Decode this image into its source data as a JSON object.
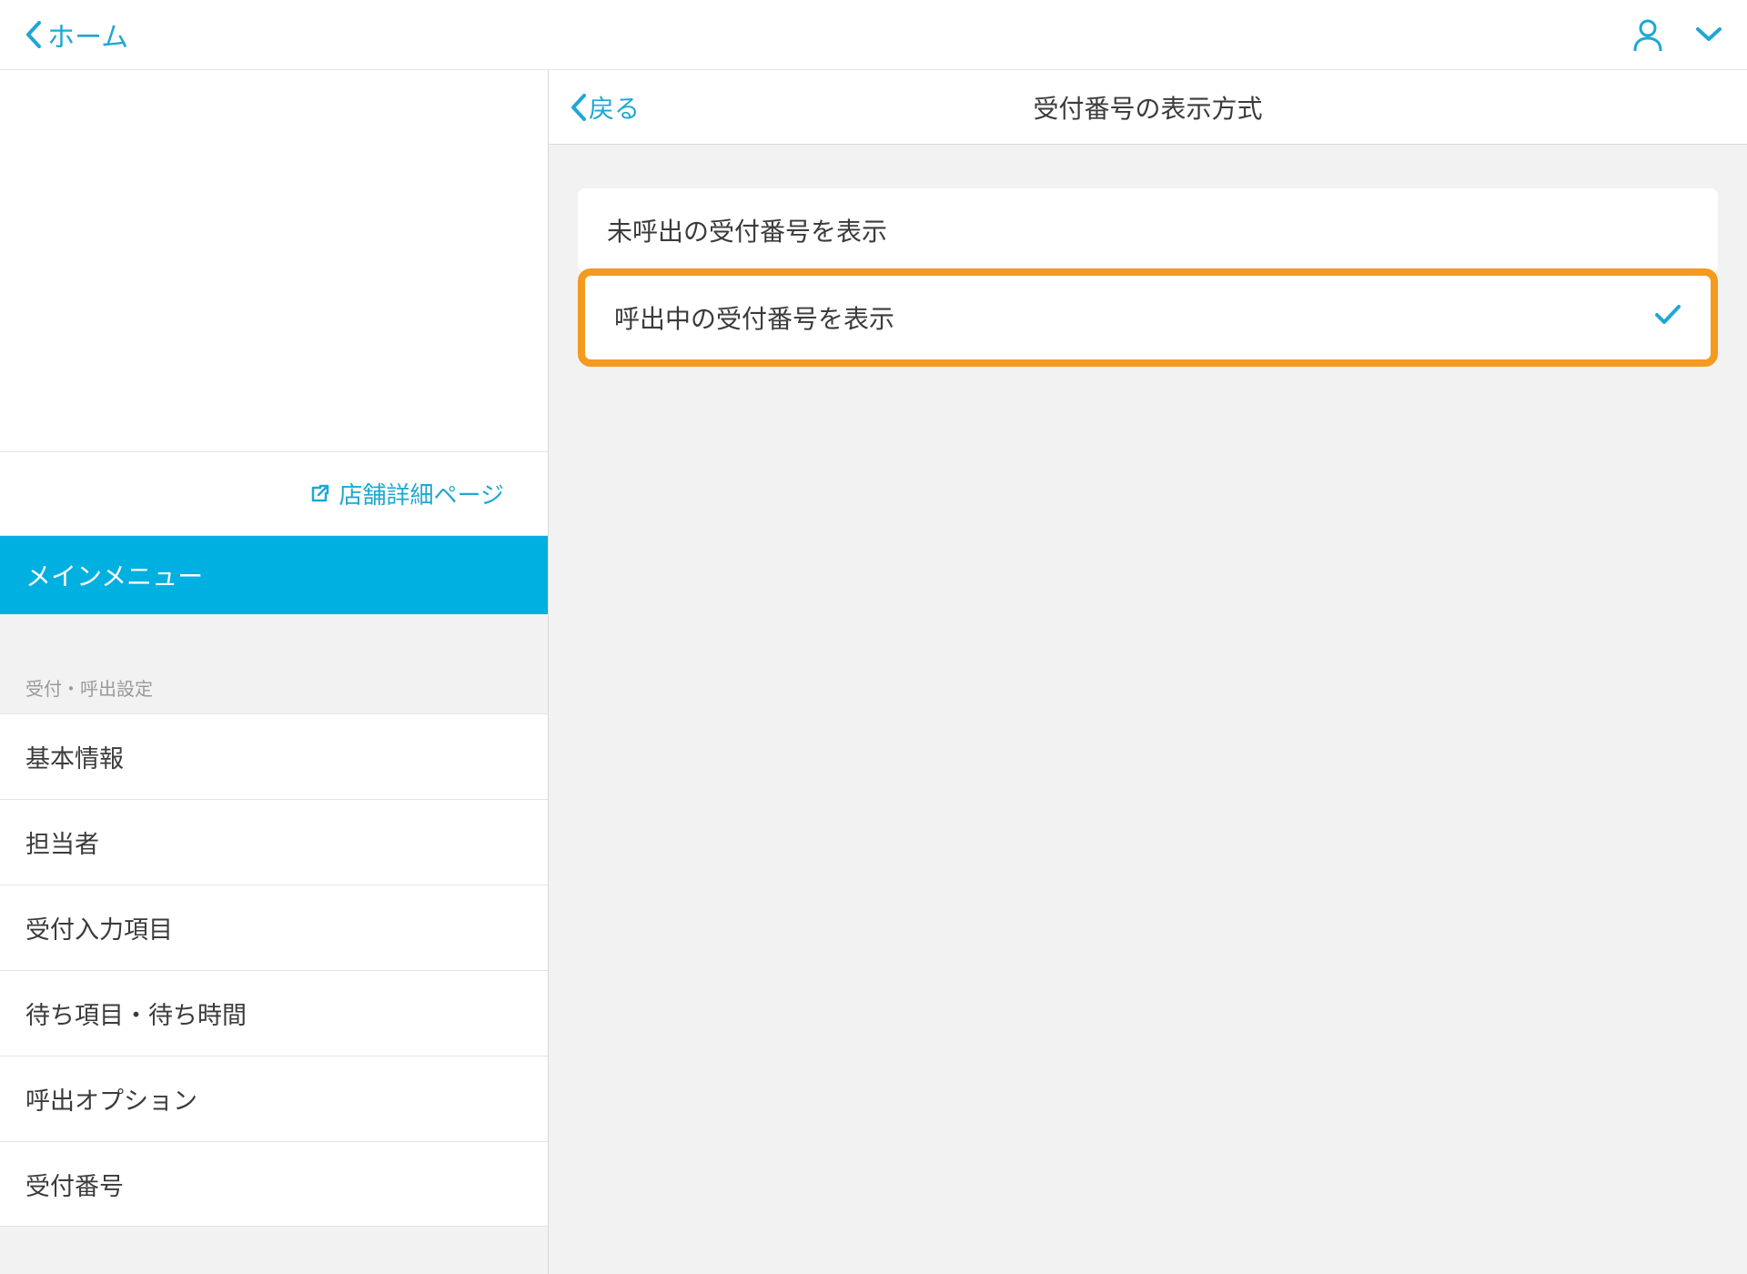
{
  "colors": {
    "accent": "#1fa7d4",
    "highlight": "#f39a1f",
    "mainMenuBg": "#00b0e0"
  },
  "header": {
    "home_label": "ホーム"
  },
  "sidebar": {
    "store_detail_label": "店舗詳細ページ",
    "main_menu_label": "メインメニュー",
    "section_label": "受付・呼出設定",
    "items": [
      {
        "label": "基本情報"
      },
      {
        "label": "担当者"
      },
      {
        "label": "受付入力項目"
      },
      {
        "label": "待ち項目・待ち時間"
      },
      {
        "label": "呼出オプション"
      },
      {
        "label": "受付番号"
      }
    ]
  },
  "content": {
    "back_label": "戻る",
    "title": "受付番号の表示方式",
    "options": [
      {
        "label": "未呼出の受付番号を表示",
        "selected": false,
        "highlighted": false
      },
      {
        "label": "呼出中の受付番号を表示",
        "selected": true,
        "highlighted": true
      }
    ]
  }
}
